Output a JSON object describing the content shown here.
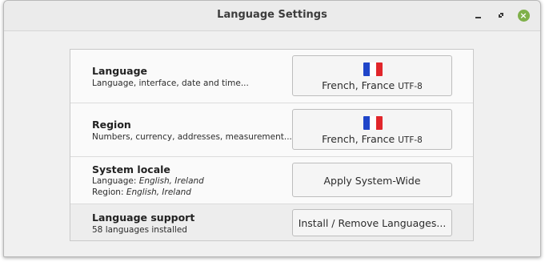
{
  "window": {
    "title": "Language Settings",
    "controls": {
      "minimize_icon": "minimize-icon",
      "maximize_icon": "maximize-icon",
      "close_icon": "close-icon",
      "close_glyph": "×",
      "close_color": "#7fb04a"
    }
  },
  "rows": {
    "language": {
      "heading": "Language",
      "description": "Language, interface, date and time...",
      "button": {
        "flag_icon": "france-flag-icon",
        "locale": "French, France",
        "encoding": "UTF-8"
      }
    },
    "region": {
      "heading": "Region",
      "description": "Numbers, currency, addresses, measurement...",
      "button": {
        "flag_icon": "france-flag-icon",
        "locale": "French, France",
        "encoding": "UTF-8"
      }
    },
    "system_locale": {
      "heading": "System locale",
      "language_label": "Language:",
      "language_value": "English, Ireland",
      "region_label": "Region:",
      "region_value": "English, Ireland",
      "button_label": "Apply System-Wide"
    },
    "language_support": {
      "heading": "Language support",
      "description": "58 languages installed",
      "button_label": "Install / Remove Languages..."
    }
  },
  "colors": {
    "flag_blue": "#1f45c9",
    "flag_white": "#ffffff",
    "flag_red": "#e1262b"
  }
}
